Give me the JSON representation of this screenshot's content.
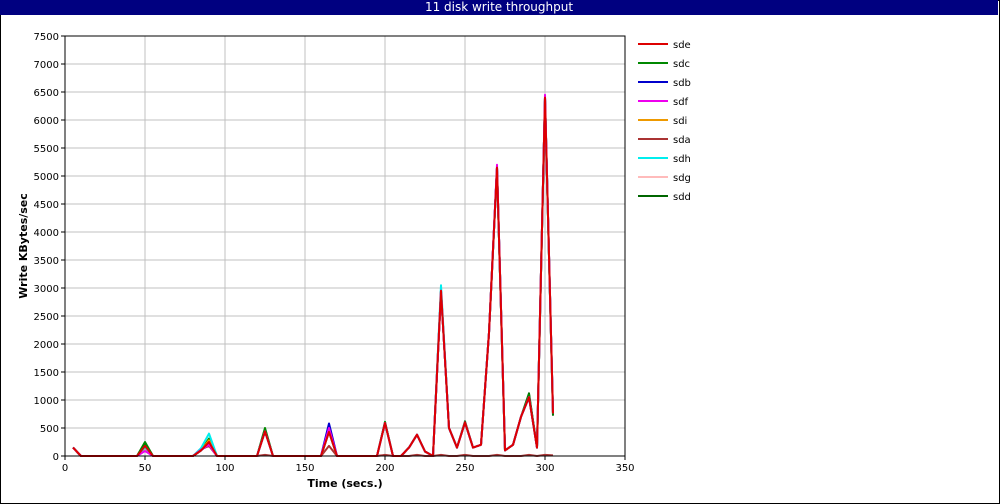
{
  "chart_data": {
    "type": "line",
    "title": "11 disk write throughput",
    "xlabel": "Time (secs.)",
    "ylabel": "Write KBytes/sec",
    "xlim": [
      0,
      350
    ],
    "ylim": [
      0,
      7500
    ],
    "xticks": [
      0,
      50,
      100,
      150,
      200,
      250,
      300,
      350
    ],
    "yticks": [
      0,
      500,
      1000,
      1500,
      2000,
      2500,
      3000,
      3500,
      4000,
      4500,
      5000,
      5500,
      6000,
      6500,
      7000,
      7500
    ],
    "grid": true,
    "legend_position": "right",
    "x": [
      5,
      10,
      15,
      20,
      25,
      30,
      35,
      40,
      45,
      50,
      55,
      60,
      65,
      70,
      75,
      80,
      85,
      90,
      95,
      100,
      105,
      110,
      115,
      120,
      125,
      130,
      135,
      140,
      145,
      150,
      155,
      160,
      165,
      170,
      175,
      180,
      185,
      190,
      195,
      200,
      205,
      210,
      215,
      220,
      225,
      230,
      235,
      240,
      245,
      250,
      255,
      260,
      265,
      270,
      275,
      280,
      285,
      290,
      295,
      300,
      305
    ],
    "series": [
      {
        "name": "sde",
        "color": "#dd0000",
        "values": [
          150,
          0,
          0,
          0,
          0,
          0,
          0,
          0,
          0,
          180,
          0,
          0,
          0,
          0,
          0,
          0,
          100,
          250,
          0,
          0,
          0,
          0,
          0,
          0,
          440,
          0,
          0,
          0,
          0,
          0,
          0,
          0,
          430,
          0,
          0,
          0,
          0,
          0,
          0,
          590,
          0,
          0,
          150,
          380,
          80,
          0,
          2950,
          500,
          150,
          600,
          150,
          200,
          2200,
          5150,
          100,
          200,
          700,
          1050,
          150,
          6400,
          760
        ]
      },
      {
        "name": "sdc",
        "color": "#008800",
        "values": [
          150,
          0,
          0,
          0,
          0,
          0,
          0,
          0,
          0,
          250,
          0,
          0,
          0,
          0,
          0,
          0,
          100,
          310,
          0,
          0,
          0,
          0,
          0,
          0,
          500,
          0,
          0,
          0,
          0,
          0,
          0,
          0,
          460,
          0,
          0,
          0,
          0,
          0,
          0,
          610,
          0,
          0,
          150,
          380,
          80,
          0,
          2950,
          500,
          150,
          600,
          150,
          200,
          2200,
          5150,
          100,
          200,
          700,
          1100,
          150,
          6400,
          740
        ]
      },
      {
        "name": "sdb",
        "color": "#0000cc",
        "values": [
          150,
          0,
          0,
          0,
          0,
          0,
          0,
          0,
          0,
          160,
          0,
          0,
          0,
          0,
          0,
          0,
          100,
          220,
          0,
          0,
          0,
          0,
          0,
          0,
          440,
          0,
          0,
          0,
          0,
          0,
          0,
          0,
          580,
          0,
          0,
          0,
          0,
          0,
          0,
          590,
          0,
          0,
          150,
          380,
          80,
          0,
          2950,
          500,
          150,
          600,
          150,
          200,
          2200,
          5150,
          100,
          200,
          700,
          1050,
          150,
          6400,
          760
        ]
      },
      {
        "name": "sdf",
        "color": "#ee00ee",
        "values": [
          150,
          0,
          0,
          0,
          0,
          0,
          0,
          0,
          0,
          90,
          0,
          0,
          0,
          0,
          0,
          0,
          110,
          200,
          0,
          0,
          0,
          0,
          0,
          0,
          440,
          0,
          0,
          0,
          0,
          0,
          0,
          0,
          500,
          0,
          0,
          0,
          0,
          0,
          0,
          590,
          0,
          0,
          150,
          380,
          80,
          0,
          2950,
          500,
          150,
          600,
          150,
          200,
          2200,
          5200,
          100,
          200,
          700,
          1050,
          150,
          6450,
          760
        ]
      },
      {
        "name": "sdi",
        "color": "#ee9900",
        "values": [
          150,
          0,
          0,
          0,
          0,
          0,
          0,
          0,
          0,
          150,
          0,
          0,
          0,
          0,
          0,
          0,
          100,
          280,
          0,
          0,
          0,
          0,
          0,
          0,
          440,
          0,
          0,
          0,
          0,
          0,
          0,
          0,
          430,
          0,
          0,
          0,
          0,
          0,
          0,
          590,
          0,
          0,
          150,
          380,
          80,
          0,
          2950,
          500,
          150,
          600,
          150,
          200,
          2200,
          5150,
          100,
          200,
          700,
          1050,
          150,
          6400,
          760
        ]
      },
      {
        "name": "sda",
        "color": "#aa3333",
        "values": [
          150,
          0,
          0,
          0,
          0,
          0,
          0,
          0,
          0,
          200,
          0,
          0,
          0,
          0,
          0,
          0,
          120,
          180,
          0,
          0,
          0,
          0,
          0,
          0,
          20,
          0,
          0,
          0,
          0,
          0,
          0,
          0,
          180,
          0,
          0,
          0,
          0,
          0,
          0,
          20,
          0,
          0,
          0,
          20,
          0,
          0,
          20,
          0,
          0,
          20,
          0,
          0,
          0,
          20,
          0,
          0,
          0,
          20,
          0,
          20,
          10
        ]
      },
      {
        "name": "sdh",
        "color": "#00eeee",
        "values": [
          150,
          0,
          0,
          0,
          0,
          0,
          0,
          0,
          0,
          160,
          0,
          0,
          0,
          0,
          0,
          0,
          140,
          400,
          0,
          0,
          0,
          0,
          0,
          0,
          440,
          0,
          0,
          0,
          0,
          0,
          0,
          0,
          430,
          0,
          0,
          0,
          0,
          0,
          0,
          590,
          0,
          0,
          150,
          380,
          80,
          0,
          3050,
          500,
          150,
          600,
          150,
          200,
          2200,
          5150,
          100,
          200,
          700,
          1050,
          150,
          6400,
          760
        ]
      },
      {
        "name": "sdg",
        "color": "#ffbbbb",
        "values": [
          150,
          0,
          0,
          0,
          0,
          0,
          0,
          0,
          0,
          120,
          0,
          0,
          0,
          0,
          0,
          0,
          100,
          250,
          0,
          0,
          0,
          0,
          0,
          0,
          440,
          0,
          0,
          0,
          0,
          0,
          0,
          0,
          430,
          0,
          0,
          0,
          0,
          0,
          0,
          590,
          0,
          0,
          150,
          380,
          80,
          0,
          2950,
          500,
          150,
          600,
          150,
          200,
          2200,
          5150,
          100,
          200,
          700,
          1050,
          150,
          6400,
          760
        ]
      },
      {
        "name": "sdd",
        "color": "#006600",
        "values": [
          150,
          0,
          0,
          0,
          0,
          0,
          0,
          0,
          0,
          220,
          0,
          0,
          0,
          0,
          0,
          0,
          100,
          300,
          0,
          0,
          0,
          0,
          0,
          0,
          480,
          0,
          0,
          0,
          0,
          0,
          0,
          0,
          440,
          0,
          0,
          0,
          0,
          0,
          0,
          600,
          0,
          0,
          150,
          380,
          80,
          0,
          2950,
          500,
          150,
          620,
          150,
          200,
          2200,
          5150,
          100,
          200,
          700,
          1120,
          150,
          6400,
          720
        ]
      }
    ],
    "draw_order": [
      "sda",
      "sdg",
      "sdd",
      "sdc",
      "sdi",
      "sdb",
      "sdh",
      "sdf",
      "sde"
    ]
  }
}
